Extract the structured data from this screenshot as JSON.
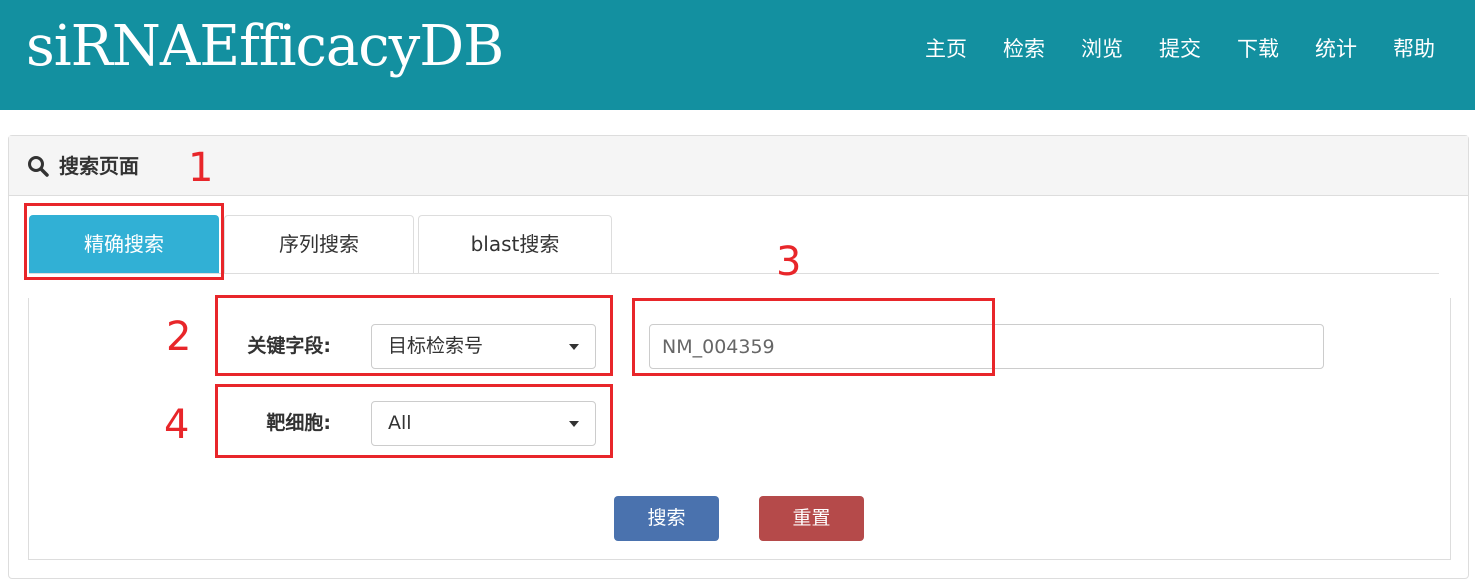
{
  "header": {
    "brand": "siRNAEfficacyDB",
    "nav": [
      "主页",
      "检索",
      "浏览",
      "提交",
      "下载",
      "统计",
      "帮助"
    ]
  },
  "panel": {
    "title": "搜索页面",
    "icon": "search-icon"
  },
  "tabs": [
    {
      "label": "精确搜索",
      "active": true
    },
    {
      "label": "序列搜索",
      "active": false
    },
    {
      "label": "blast搜索",
      "active": false
    }
  ],
  "form": {
    "keyword_label": "关键字段:",
    "keyword_value": "目标检索号",
    "search_value": "NM_004359",
    "cell_label": "靶细胞:",
    "cell_value": "All",
    "search_button": "搜索",
    "reset_button": "重置"
  },
  "annotations": [
    "1",
    "2",
    "3",
    "4"
  ],
  "colors": {
    "navbar": "#1390a0",
    "active_tab": "#31b0d5",
    "search_button": "#4a72ae",
    "reset_button": "#b54a4a",
    "annotation": "#e8262a"
  }
}
